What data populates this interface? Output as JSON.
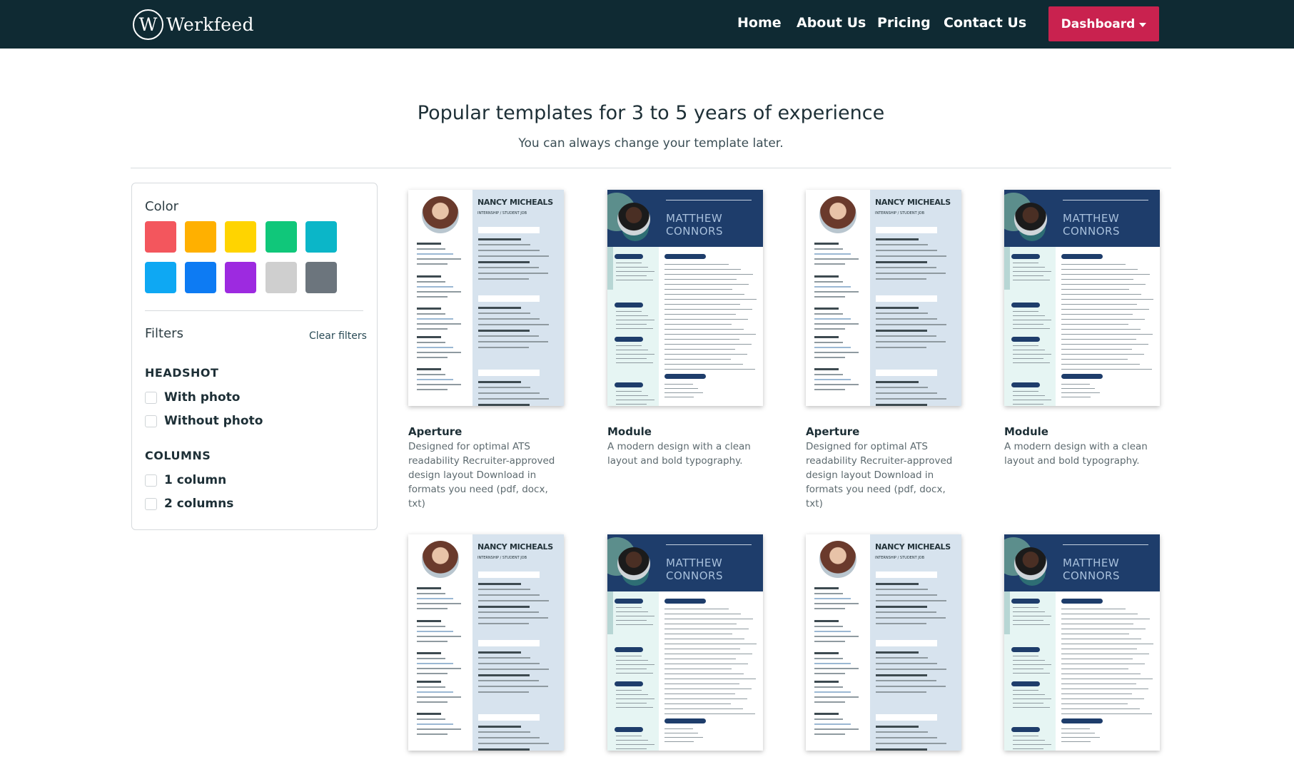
{
  "brand": {
    "logo_letter": "W",
    "name": "Werkfeed"
  },
  "nav": {
    "links": [
      "Home",
      "About Us",
      "Pricing",
      "Contact Us"
    ],
    "dashboard_label": "Dashboard"
  },
  "header": {
    "title": "Popular templates for 3 to 5 years of experience",
    "subtitle": "You can always change your template later."
  },
  "sidebar": {
    "color_heading": "Color",
    "colors": [
      "#f3565d",
      "#ffb000",
      "#ffd400",
      "#10c77a",
      "#0bb6c8",
      "#0ea8f3",
      "#0d7bf3",
      "#9d2ae0",
      "#cfcfcf",
      "#6c757d"
    ],
    "filters_heading": "Filters",
    "clear_filters": "Clear filters",
    "groups": [
      {
        "title": "HEADSHOT",
        "options": [
          "With photo",
          "Without photo"
        ]
      },
      {
        "title": "COLUMNS",
        "options": [
          "1 column",
          "2 columns"
        ]
      }
    ]
  },
  "templates": [
    {
      "name": "Aperture",
      "description": "Designed for optimal ATS readability Recruiter-approved design layout Download in formats you need (pdf, docx, txt)",
      "preview_name": "NANCY MICHEALS",
      "preview_sub": "INTERNSHIP / STUDENT JOB"
    },
    {
      "name": "Module",
      "description": "A modern design with a clean layout and bold typography.",
      "preview_name_1": "MATTHEW",
      "preview_name_2": "CONNORS"
    },
    {
      "name": "Aperture",
      "description": "Designed for optimal ATS readability Recruiter-approved design layout Download in formats you need (pdf, docx, txt)",
      "preview_name": "NANCY MICHEALS",
      "preview_sub": "INTERNSHIP / STUDENT JOB"
    },
    {
      "name": "Module",
      "description": "A modern design with a clean layout and bold typography.",
      "preview_name_1": "MATTHEW",
      "preview_name_2": "CONNORS"
    },
    {
      "name": "",
      "description": "",
      "preview_name": "NANCY MICHEALS",
      "preview_sub": "INTERNSHIP / STUDENT JOB"
    },
    {
      "name": "",
      "description": "",
      "preview_name_1": "MATTHEW",
      "preview_name_2": "CONNORS"
    },
    {
      "name": "",
      "description": "",
      "preview_name": "NANCY MICHEALS",
      "preview_sub": "INTERNSHIP / STUDENT JOB"
    },
    {
      "name": "",
      "description": "",
      "preview_name_1": "MATTHEW",
      "preview_name_2": "CONNORS"
    }
  ]
}
